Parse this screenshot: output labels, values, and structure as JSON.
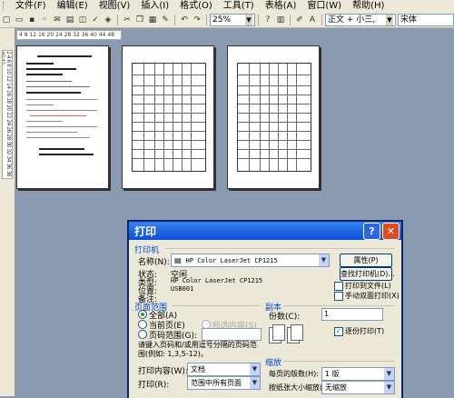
{
  "menubar": {
    "items": [
      "文件(F)",
      "编辑(E)",
      "视图(V)",
      "插入(I)",
      "格式(O)",
      "工具(T)",
      "表格(A)",
      "窗口(W)",
      "帮助(H)"
    ]
  },
  "toolbar": {
    "zoom": "25%",
    "style": "正文 + 小三,",
    "font": "宋体"
  },
  "ruler": {
    "horizontal": "4  8  12  16  20  24  28  32  36  40  44  48",
    "vertical": "2 4 6 8 10 12 14 16 18 20 22 24 26 28 30 32 34 36 38 40 42"
  },
  "dialog": {
    "title": "打印",
    "printer": {
      "section": "打印机",
      "name_label": "名称(N):",
      "name_value": "HP Color LaserJet CP1215",
      "status_label": "状态:",
      "status_value": "空闲",
      "type_label": "类型:",
      "type_value": "HP Color LaserJet CP1215",
      "location_label": "位置:",
      "location_value": "USB001",
      "comment_label": "备注:",
      "properties_button": "属性(P)",
      "find_button": "查找打印机(D)...",
      "print_to_file": "打印到文件(L)",
      "manual_duplex": "手动双面打印(X)"
    },
    "page_range": {
      "section": "页面范围",
      "all": "全部(A)",
      "current": "当前页(E)",
      "selection": "所选内容(S)",
      "pages": "页码范围(G):",
      "hint": "请键入页码和/或用逗号分隔的页码范围(例如: 1,3,5-12)。"
    },
    "copies": {
      "section": "副本",
      "count_label": "份数(C):",
      "count_value": "1",
      "collate": "逐份打印(T)"
    },
    "print_what": {
      "label": "打印内容(W):",
      "value": "文档"
    },
    "print": {
      "label": "打印(R):",
      "value": "范围中所有页面"
    },
    "zoom": {
      "section": "缩放",
      "pages_per_sheet_label": "每页的版数(H):",
      "pages_per_sheet_value": "1 版",
      "scale_label": "按纸张大小缩放(Z):",
      "scale_value": "无缩放"
    }
  }
}
